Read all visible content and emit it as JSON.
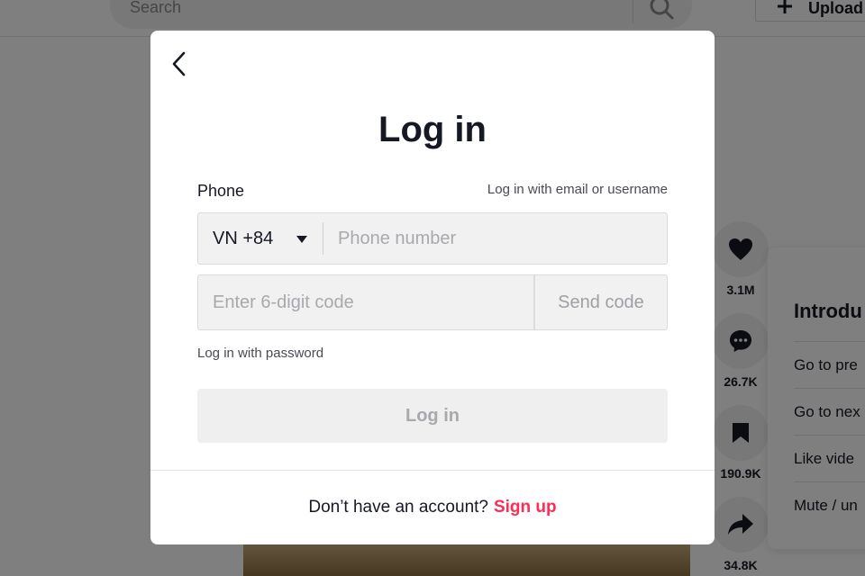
{
  "header": {
    "search_placeholder": "Search",
    "upload_label": "Upload"
  },
  "actions": [
    {
      "icon": "heart-icon",
      "count": "3.1M"
    },
    {
      "icon": "comment-icon",
      "count": "26.7K"
    },
    {
      "icon": "bookmark-icon",
      "count": "190.9K"
    },
    {
      "icon": "share-icon",
      "count": "34.8K"
    }
  ],
  "shortcuts": {
    "title": "Introdu",
    "items": [
      "Go to pre",
      "Go to nex",
      "Like vide",
      "Mute / un"
    ]
  },
  "modal": {
    "title": "Log in",
    "phone_label": "Phone",
    "email_link": "Log in with email or username",
    "country_code": "VN +84",
    "phone_placeholder": "Phone number",
    "code_placeholder": "Enter 6-digit code",
    "send_code_label": "Send code",
    "password_link": "Log in with password",
    "login_button_label": "Log in",
    "footer_text": "Don’t have an account?",
    "signup_label": "Sign up"
  },
  "colors": {
    "accent": "#fe2c55",
    "overlay": "rgba(0,0,0,0.5)",
    "input_bg": "#f1f1f2"
  }
}
